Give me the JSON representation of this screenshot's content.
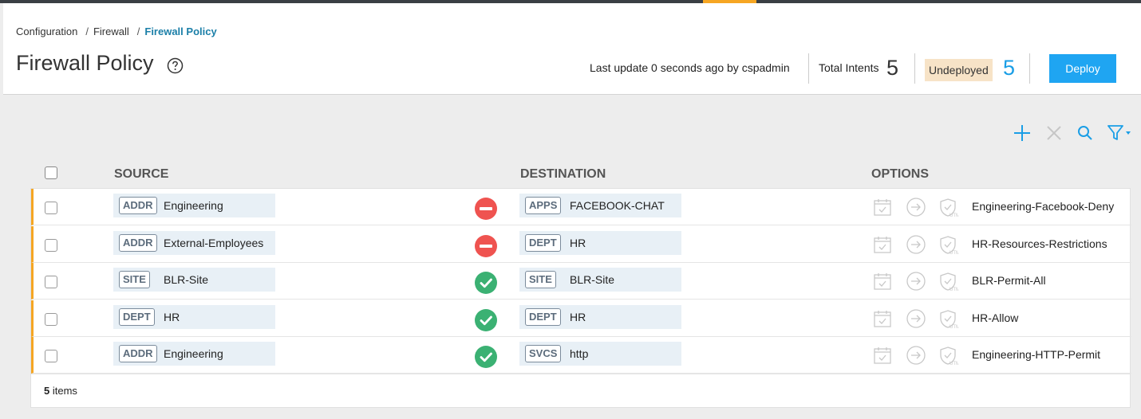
{
  "breadcrumb": {
    "items": [
      "Configuration",
      "Firewall"
    ],
    "current": "Firewall Policy",
    "separator": "/"
  },
  "page": {
    "title": "Firewall Policy",
    "help_icon": "question-circle-icon"
  },
  "status": {
    "last_update": "Last update 0 seconds ago by cspadmin",
    "total_label": "Total Intents",
    "total_count": "5",
    "undeployed_label": "Undeployed",
    "undeployed_count": "5",
    "deploy_label": "Deploy"
  },
  "toolbar": {
    "icons": [
      "add-icon",
      "delete-icon",
      "search-icon",
      "filter-icon"
    ]
  },
  "columns": {
    "source": "SOURCE",
    "destination": "DESTINATION",
    "options": "OPTIONS"
  },
  "rows": [
    {
      "source_tag": "ADDR",
      "source": "Engineering",
      "action": "deny",
      "dest_tag": "APPS",
      "destination": "FACEBOOK-CHAT",
      "name": "Engineering-Facebook-Deny"
    },
    {
      "source_tag": "ADDR",
      "source": "External-Employees",
      "action": "deny",
      "dest_tag": "DEPT",
      "destination": "HR",
      "name": "HR-Resources-Restrictions"
    },
    {
      "source_tag": "SITE",
      "source": "BLR-Site",
      "action": "allow",
      "dest_tag": "SITE",
      "destination": "BLR-Site",
      "name": "BLR-Permit-All"
    },
    {
      "source_tag": "DEPT",
      "source": "HR",
      "action": "allow",
      "dest_tag": "DEPT",
      "destination": "HR",
      "name": "HR-Allow"
    },
    {
      "source_tag": "ADDR",
      "source": "Engineering",
      "action": "allow",
      "dest_tag": "SVCS",
      "destination": "http",
      "name": "Engineering-HTTP-Permit"
    }
  ],
  "options_icons": [
    "schedule-icon",
    "redirect-icon",
    "utm-shield-icon"
  ],
  "footer": {
    "count": "5",
    "label": "items"
  },
  "colors": {
    "accent": "#1fa5f2",
    "row_marker": "#f5a623",
    "deny": "#ef5350",
    "allow": "#3bb173"
  }
}
